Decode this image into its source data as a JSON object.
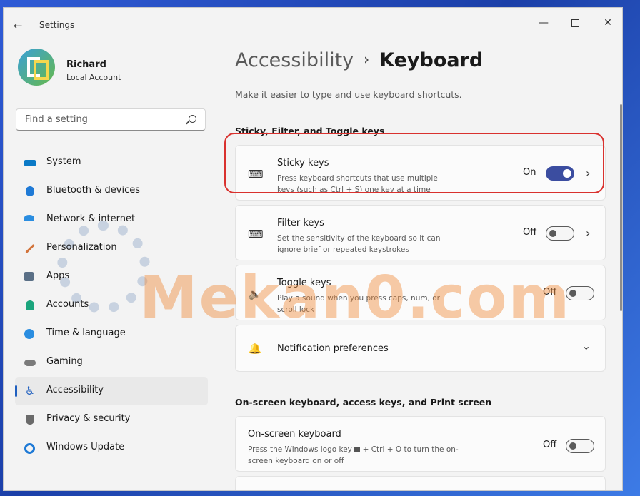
{
  "app": {
    "title": "Settings",
    "back_icon": "back-arrow-icon"
  },
  "window_controls": {
    "minimize": "minimize-icon",
    "maximize": "maximize-icon",
    "close": "close-icon"
  },
  "user": {
    "name": "Richard",
    "account_type": "Local Account"
  },
  "search": {
    "placeholder": "Find a setting"
  },
  "sidebar": {
    "items": [
      {
        "label": "System",
        "icon": "system-icon",
        "color": "#0a79c6"
      },
      {
        "label": "Bluetooth & devices",
        "icon": "bluetooth-icon",
        "color": "#1f7ad6"
      },
      {
        "label": "Network & internet",
        "icon": "wifi-icon",
        "color": "#2a8de0"
      },
      {
        "label": "Personalization",
        "icon": "brush-icon",
        "color": "#d2733a"
      },
      {
        "label": "Apps",
        "icon": "apps-icon",
        "color": "#5a6f86"
      },
      {
        "label": "Accounts",
        "icon": "person-icon",
        "color": "#1ba57d"
      },
      {
        "label": "Time & language",
        "icon": "clock-globe-icon",
        "color": "#2a8de0"
      },
      {
        "label": "Gaming",
        "icon": "controller-icon",
        "color": "#7a7a7a"
      },
      {
        "label": "Accessibility",
        "icon": "accessibility-icon",
        "color": "#1f5fbf",
        "active": true
      },
      {
        "label": "Privacy & security",
        "icon": "shield-icon",
        "color": "#6a6a6a"
      },
      {
        "label": "Windows Update",
        "icon": "update-icon",
        "color": "#1f7ad6"
      }
    ]
  },
  "breadcrumb": {
    "parent": "Accessibility",
    "separator": "›",
    "current": "Keyboard"
  },
  "page": {
    "description": "Make it easier to type and use keyboard shortcuts."
  },
  "sections": {
    "sticky": {
      "title": "Sticky, Filter, and Toggle keys"
    },
    "onscreen": {
      "title": "On-screen keyboard, access keys, and Print screen"
    }
  },
  "cards": {
    "sticky_keys": {
      "title": "Sticky keys",
      "desc": "Press keyboard shortcuts that use multiple keys (such as Ctrl + S) one key at a time",
      "state": "On",
      "icon": "keyboard-icon"
    },
    "filter_keys": {
      "title": "Filter keys",
      "desc": "Set the sensitivity of the keyboard so it can ignore brief or repeated keystrokes",
      "state": "Off",
      "icon": "keyboard-clock-icon"
    },
    "toggle_keys": {
      "title": "Toggle keys",
      "desc": "Play a sound when you press caps, num, or scroll lock",
      "state": "Off",
      "icon": "speaker-icon"
    },
    "notification": {
      "title": "Notification preferences",
      "icon": "bell-icon"
    },
    "onscreen_keyboard": {
      "title": "On-screen keyboard",
      "desc_part1": "Press the Windows logo key",
      "desc_part2": "+ Ctrl + O to turn the on-screen keyboard on or off",
      "state": "Off"
    }
  },
  "watermark": {
    "text": "Mekan0.com"
  },
  "colors": {
    "accent": "#3b4da0",
    "highlight": "#d9312e",
    "watermark": "#f08c3c"
  }
}
